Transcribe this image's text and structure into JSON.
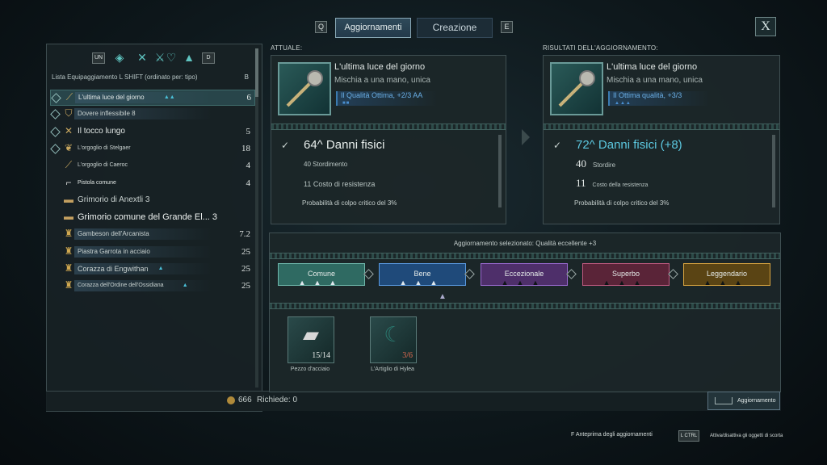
{
  "topbar": {
    "key_left": "Q",
    "tab_active": "Aggiornamenti",
    "tab_inactive": "Creazione",
    "key_right": "E",
    "close": "X"
  },
  "filters": {
    "key_left": "UN",
    "key_right": "D",
    "icons": [
      "bag-icon",
      "crossed-tools-icon",
      "crossed-swords-icon",
      "armor-icon",
      "anvil-icon"
    ]
  },
  "sort_bar": {
    "text": "Lista Equipaggiamento L SHIFT (ordinato per: tipo)",
    "key": "B"
  },
  "inventory": [
    {
      "name": "L'ultima luce del giorno",
      "suffix": "▲▲",
      "qty": "6",
      "icon": "mace-icon",
      "color": "#e2e8e6",
      "size": 8,
      "selected": true
    },
    {
      "name": "Dovere inflessibile 8",
      "suffix": "",
      "qty": "",
      "icon": "shield-icon",
      "color": "#c9d2d0",
      "size": 8
    },
    {
      "name": "Il tocco lungo",
      "suffix": "",
      "qty": "5",
      "icon": "crossbow-icon",
      "color": "#e2e8e6",
      "size": 10
    },
    {
      "name": "L'orgoglio di Stelgaer",
      "suffix": "",
      "qty": "18",
      "icon": "gloves-icon",
      "color": "#c9d2d0",
      "size": 7
    },
    {
      "name": "L'orgoglio di Caeroc",
      "suffix": "",
      "qty": "4",
      "icon": "sword-icon",
      "color": "#c9d2d0",
      "size": 7
    },
    {
      "name": "Pistola comune",
      "suffix": "",
      "qty": "4",
      "icon": "pistol-icon",
      "color": "#e2e8e6",
      "size": 7
    },
    {
      "name": "Grimorio di Anextli 3",
      "suffix": "",
      "qty": "",
      "icon": "book-icon",
      "color": "#c9d2d0",
      "size": 10
    },
    {
      "name": "Grimorio comune del Grande El... 3",
      "suffix": "",
      "qty": "",
      "icon": "book-icon",
      "color": "#eef2f0",
      "size": 11
    },
    {
      "name": "Gambeson dell'Arcanista",
      "suffix": "",
      "qty": "7.2",
      "icon": "chest-armor-icon",
      "color": "#c9d2d0",
      "size": 8
    },
    {
      "name": "Piastra Garrota in acciaio",
      "suffix": "",
      "qty": "25",
      "icon": "chest-armor-icon",
      "color": "#c9d2d0",
      "size": 8
    },
    {
      "name": "Corazza di Engwithan",
      "suffix": "▲",
      "qty": "25",
      "icon": "chest-armor-icon",
      "color": "#c9d2d0",
      "size": 9
    },
    {
      "name": "Corazza dell'Ordine dell'Ossidiana",
      "suffix": "▲",
      "qty": "25",
      "icon": "chest-armor-icon",
      "color": "#c9d2d0",
      "size": 7
    }
  ],
  "footer": {
    "coins": "666",
    "requests": "Richiede: 0"
  },
  "current": {
    "header": "ATTUALE:",
    "title": "L'ultima luce del giorno",
    "subtitle": "Mischia a una mano, unica",
    "quality": "Il Qualità Ottima, +2/3 AA",
    "main_stat": "64^ Danni fisici",
    "stat1": "40 Stordimento",
    "stat2": "11 Costo di resistenza",
    "crit": "Probabilità di colpo critico del 3%"
  },
  "result": {
    "header": "RISULTATI DELL'AGGIORNAMENTO:",
    "title": "L'ultima luce del giorno",
    "subtitle": "Mischia a una mano, unica",
    "quality": "Il Ottima qualità, +3/3",
    "main_stat": "72^ Danni fisici (+8)",
    "stat1_num": "40",
    "stat1_label": "Stordire",
    "stat2_num": "11",
    "stat2_label": "Costo della resistenza",
    "crit": "Probabilità di colpo critico del 3%"
  },
  "upgrade": {
    "selected": "Aggiornamento selezionato: Qualità eccellente +3",
    "tiers": [
      {
        "label": "Comune",
        "color": "#2f6a62",
        "border": "#6fb8ac"
      },
      {
        "label": "Bene",
        "color": "#1f4a7a",
        "border": "#5a9ae0"
      },
      {
        "label": "Eccezionale",
        "color": "#4e2f6a",
        "border": "#9a6ad0"
      },
      {
        "label": "Superbo",
        "color": "#5a2438",
        "border": "#c05a80"
      },
      {
        "label": "Leggendario",
        "color": "#5a4414",
        "border": "#d8a440"
      }
    ],
    "materials": [
      {
        "name": "Pezzo d'acciaio",
        "count": "15/14",
        "count_color": "#e8ecea",
        "icon": "steel-ingot-icon"
      },
      {
        "name": "L'Artiglio di Hylea",
        "count": "3/6",
        "count_color": "#e06a50",
        "icon": "claw-icon"
      }
    ],
    "button": "Aggiornamento"
  },
  "hints": {
    "preview": "F Anteprima degli aggiornamenti",
    "ctrl_key": "L CTRL",
    "toggle": "Attiva/disattiva gli oggetti di scorta"
  }
}
